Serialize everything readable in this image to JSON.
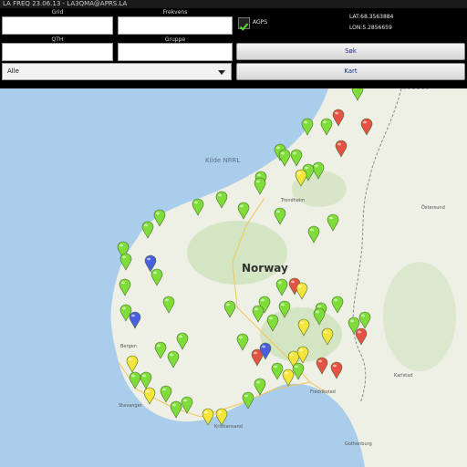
{
  "window": {
    "title": "LA FREQ 23.06.13 - LA3QMA@APRS.LA"
  },
  "form": {
    "grid_label": "Grid",
    "frekvens_label": "Frekvens",
    "qth_label": "QTH",
    "gruppe_label": "Gruppe",
    "grid_value": "",
    "frekvens_value": "",
    "qth_value": "",
    "gruppe_value": "",
    "agps_label": "AGPS",
    "agps_checked": true,
    "lat_text": "LAT:68.3563884",
    "lon_text": "LON:5.2856659",
    "filter_selected": "Alle",
    "search_button": "Søk",
    "map_button": "Kart"
  },
  "map": {
    "country_label": "Norway",
    "region_labels": [
      "Kilde NRRL",
      "Trondheim",
      "Stavanger",
      "Kristiansand",
      "Gothenburg",
      "Östersund",
      "Karlstad",
      "Fredrikstad",
      "Bergen"
    ],
    "colors": {
      "green": "#7fdd3a",
      "yellow": "#f5e53a",
      "red": "#e55245",
      "blue": "#4a5fe0",
      "land": "#eef0e6",
      "water": "#a9cdea",
      "forest": "#c9dfb3"
    },
    "pins": [
      {
        "c": "green"
      },
      {
        "c": "green"
      },
      {
        "c": "red"
      },
      {
        "c": "red"
      },
      {
        "c": "green"
      },
      {
        "c": "green"
      },
      {
        "c": "red"
      },
      {
        "c": "green"
      },
      {
        "c": "green"
      },
      {
        "c": "green"
      },
      {
        "c": "green"
      },
      {
        "c": "yellow"
      },
      {
        "c": "green"
      },
      {
        "c": "green"
      },
      {
        "c": "green"
      },
      {
        "c": "green"
      },
      {
        "c": "green"
      },
      {
        "c": "green"
      },
      {
        "c": "green"
      },
      {
        "c": "green"
      },
      {
        "c": "green"
      },
      {
        "c": "green"
      },
      {
        "c": "green"
      },
      {
        "c": "blue"
      },
      {
        "c": "green"
      },
      {
        "c": "green"
      },
      {
        "c": "green"
      },
      {
        "c": "red"
      },
      {
        "c": "yellow"
      },
      {
        "c": "green"
      },
      {
        "c": "green"
      },
      {
        "c": "green"
      },
      {
        "c": "blue"
      },
      {
        "c": "green"
      },
      {
        "c": "green"
      },
      {
        "c": "green"
      },
      {
        "c": "green"
      },
      {
        "c": "green"
      },
      {
        "c": "green"
      },
      {
        "c": "red"
      },
      {
        "c": "green"
      },
      {
        "c": "green"
      },
      {
        "c": "green"
      },
      {
        "c": "yellow"
      },
      {
        "c": "green"
      },
      {
        "c": "yellow"
      },
      {
        "c": "red"
      },
      {
        "c": "blue"
      },
      {
        "c": "green"
      },
      {
        "c": "green"
      },
      {
        "c": "yellow"
      },
      {
        "c": "red"
      },
      {
        "c": "red"
      },
      {
        "c": "green"
      },
      {
        "c": "yellow"
      },
      {
        "c": "yellow"
      },
      {
        "c": "green"
      },
      {
        "c": "green"
      },
      {
        "c": "yellow"
      },
      {
        "c": "green"
      },
      {
        "c": "green"
      },
      {
        "c": "green"
      },
      {
        "c": "yellow"
      },
      {
        "c": "green"
      },
      {
        "c": "yellow"
      },
      {
        "c": "green"
      },
      {
        "c": "green"
      },
      {
        "c": "yellow"
      },
      {
        "c": "green"
      },
      {
        "c": "green"
      }
    ]
  }
}
